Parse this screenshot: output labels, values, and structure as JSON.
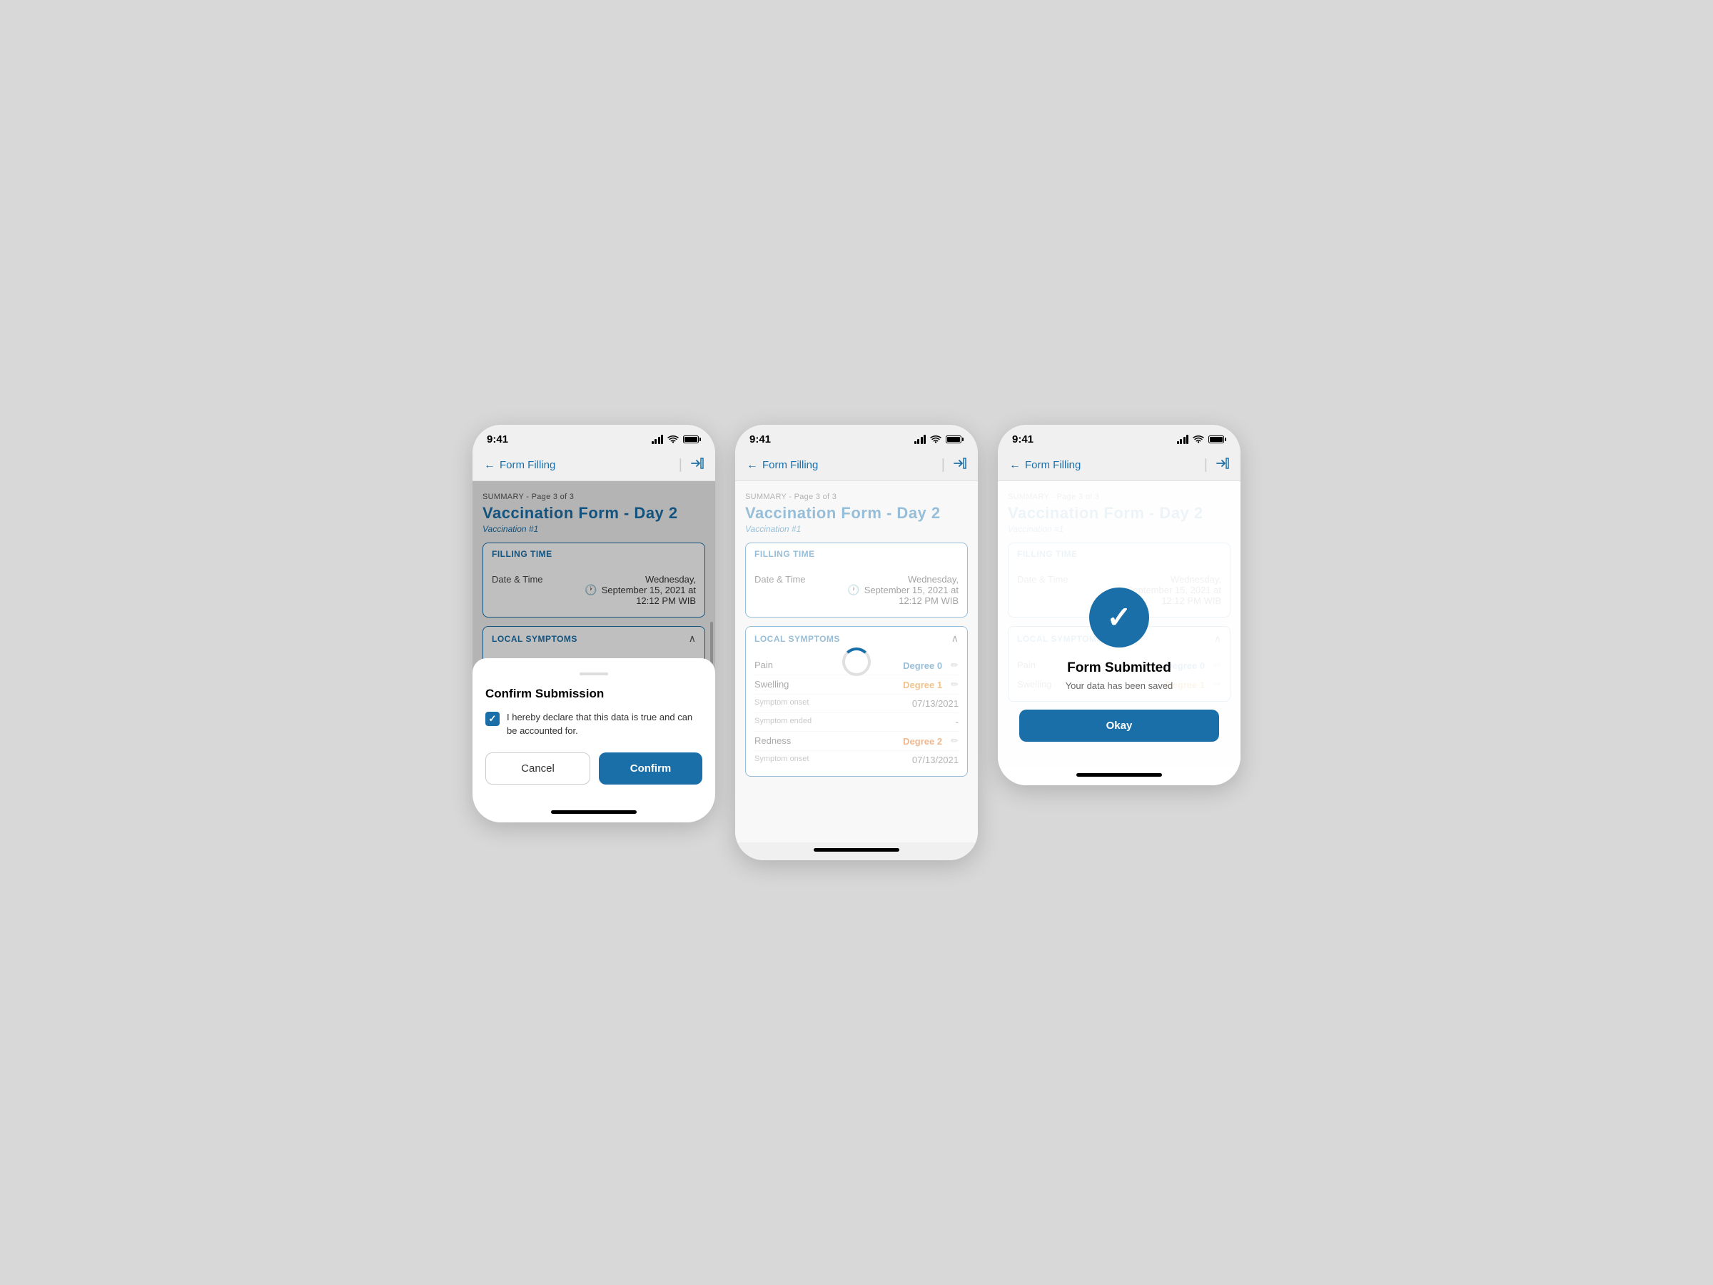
{
  "statusBar": {
    "time": "9:41"
  },
  "navBar": {
    "backLabel": "Form Filling",
    "backArrow": "←",
    "divider": "|"
  },
  "formHeader": {
    "summaryLabel": "SUMMARY - Page 3 of 3",
    "title": "Vaccination Form - Day 2",
    "subtitle": "Vaccination #1"
  },
  "fillingTimeCard": {
    "header": "FILLING TIME",
    "dateLabel": "Date & Time",
    "dateValue": "Wednesday, September 15, 2021 at 12:12 PM WIB"
  },
  "localSymptomsCard": {
    "header": "LOCAL SYMPTOMS",
    "rows": [
      {
        "label": "Pain",
        "value": "Degree 0",
        "valueType": "blue",
        "hasEdit": true
      },
      {
        "label": "Swelling",
        "value": "Degree 1",
        "valueType": "orange",
        "hasEdit": true
      },
      {
        "sublabel": "Symptom onset",
        "value": "07/13/2021",
        "valueType": "normal",
        "hasEdit": false
      },
      {
        "sublabel": "Symptom ended",
        "value": "-",
        "valueType": "normal",
        "hasEdit": false
      }
    ]
  },
  "localSymptomsCard2": {
    "header": "LOCAL SYMPTOMS",
    "rows": [
      {
        "label": "Pain",
        "value": "Degree 0",
        "valueType": "blue",
        "hasEdit": true
      },
      {
        "label": "Swelling",
        "value": "Degree 1",
        "valueType": "orange",
        "hasEdit": true
      },
      {
        "sublabel": "Symptom onset",
        "value": "07/13/2021",
        "valueType": "normal",
        "hasEdit": false
      },
      {
        "sublabel": "Symptom ended",
        "value": "-",
        "valueType": "normal",
        "hasEdit": false
      },
      {
        "label": "Redness",
        "value": "Degree 2",
        "valueType": "orange2",
        "hasEdit": true
      },
      {
        "sublabel": "Symptom onset",
        "value": "07/13/2021",
        "valueType": "normal",
        "hasEdit": false
      }
    ]
  },
  "confirmSheet": {
    "title": "Confirm Submission",
    "checkboxText": "I hereby declare that this data is true and can be accounted for.",
    "cancelLabel": "Cancel",
    "confirmLabel": "Confirm"
  },
  "successPanel": {
    "title": "Form Submitted",
    "subtitle": "Your data has been saved",
    "okayLabel": "Okay"
  },
  "homeIndicator": "home-bar",
  "colors": {
    "primary": "#1a6fa8",
    "orange": "#e07b00",
    "orange2": "#d9620a"
  }
}
